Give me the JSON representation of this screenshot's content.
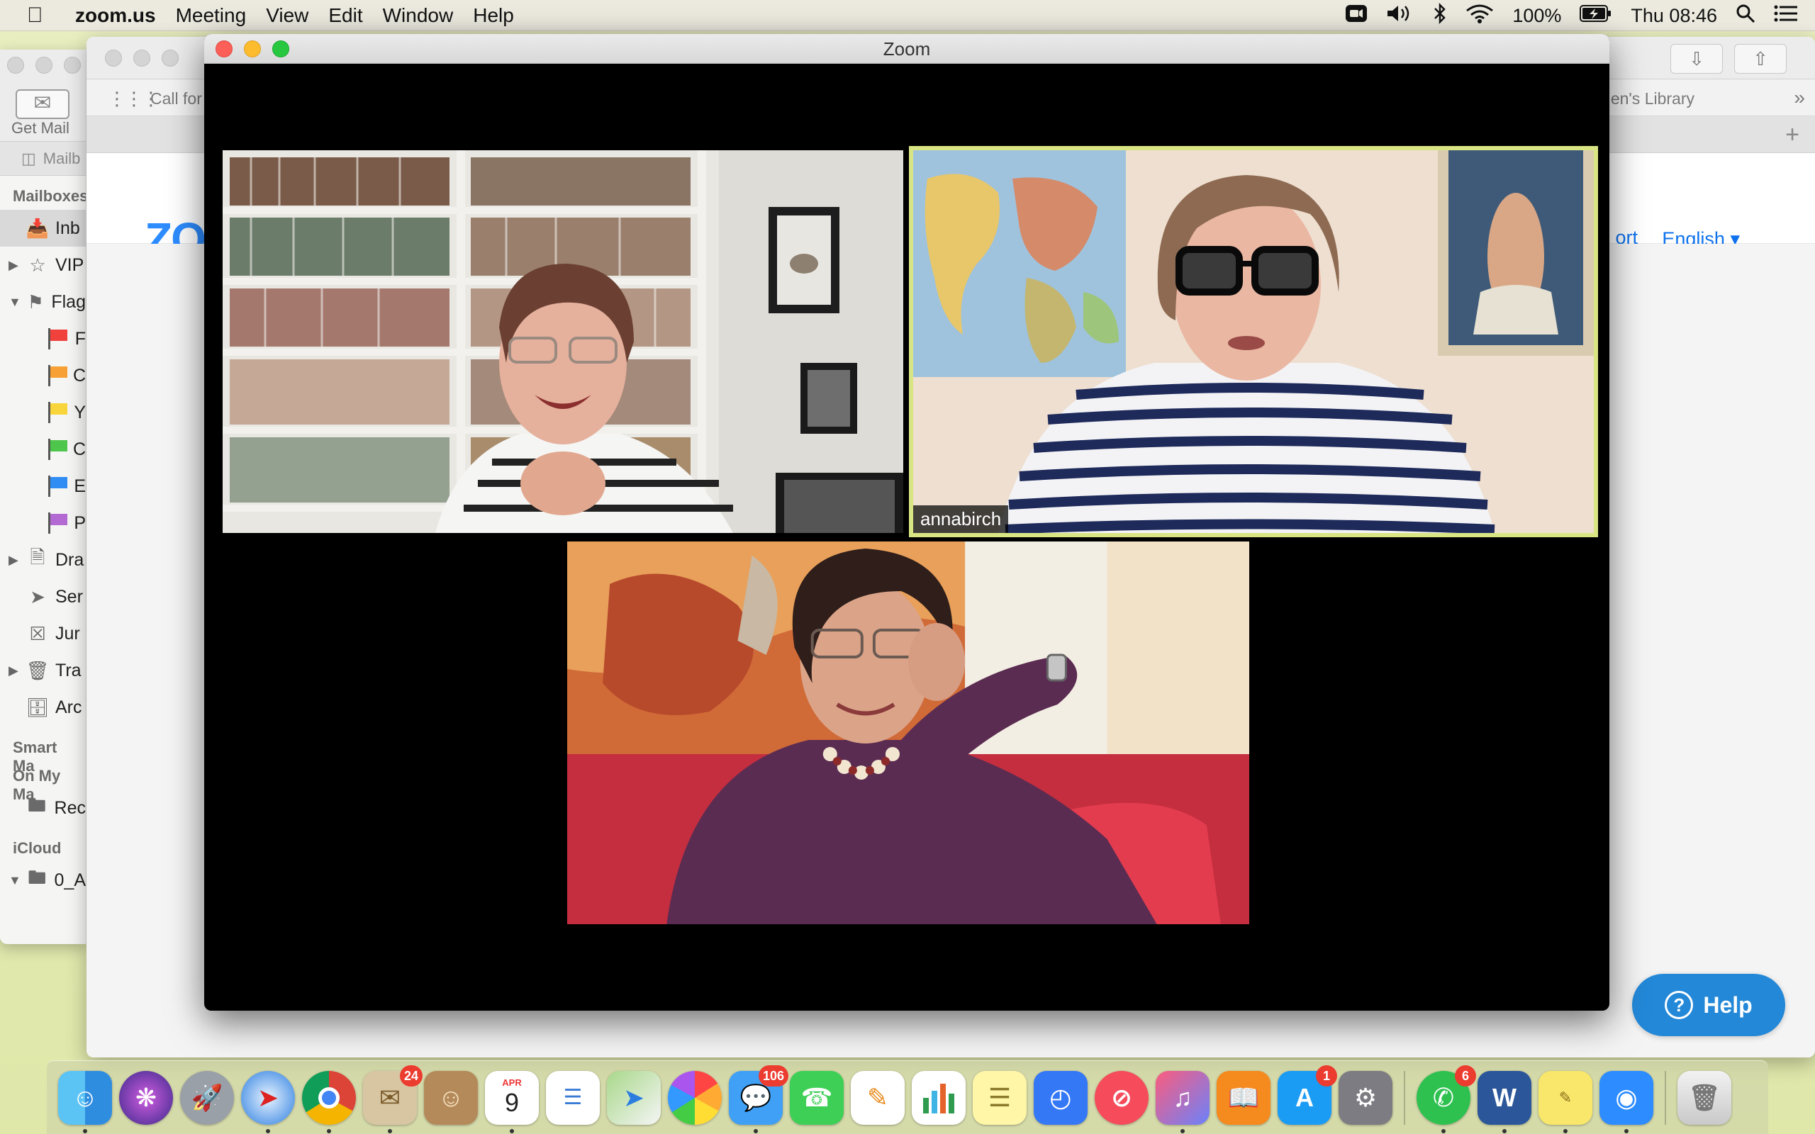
{
  "menubar": {
    "apple_icon": "apple-icon",
    "app_name": "zoom.us",
    "menus": [
      "Meeting",
      "View",
      "Edit",
      "Window",
      "Help"
    ],
    "battery": "100%",
    "clock": "Thu 08:46"
  },
  "mail": {
    "get_mail_label": "Get Mail",
    "tab_label": "Mailb",
    "sections": {
      "mailboxes": "Mailboxes",
      "smart": "Smart Ma",
      "on_my_mac": "On My Ma",
      "icloud": "iCloud"
    },
    "rows": {
      "inbox": "Inb",
      "vip": "VIP",
      "flagged": "Flag",
      "drafts": "Dra",
      "sent": "Ser",
      "junk": "Jur",
      "trash": "Tra",
      "archive": "Arc",
      "recovered": "Rec",
      "folder0": "0_A"
    },
    "flags": [
      {
        "letter": "F",
        "color": "#f0413c"
      },
      {
        "letter": "C",
        "color": "#f7a035"
      },
      {
        "letter": "Y",
        "color": "#f8d53a"
      },
      {
        "letter": "C",
        "color": "#4ec64b"
      },
      {
        "letter": "E",
        "color": "#2f8df3"
      },
      {
        "letter": "P",
        "color": "#b36ad2"
      }
    ]
  },
  "browser": {
    "bookmark_call_for": "Call for",
    "bookmark_library": "As...en's Library",
    "chevron": "»",
    "zoom_logo": "ZO",
    "support_link": "ort",
    "english_link": "English ▾",
    "help_button": "Help"
  },
  "zoom": {
    "window_title": "Zoom",
    "participant_active": "annabirch"
  },
  "dock": {
    "badges": {
      "mail": "24",
      "messages": "106",
      "appstore": "1",
      "whatsapp": "6"
    },
    "calendar_month": "APR",
    "calendar_day": "9"
  },
  "colors": {
    "active_speaker_border": "#d9e483",
    "help_button": "#2388d8",
    "zoom_blue": "#2d8cff"
  }
}
